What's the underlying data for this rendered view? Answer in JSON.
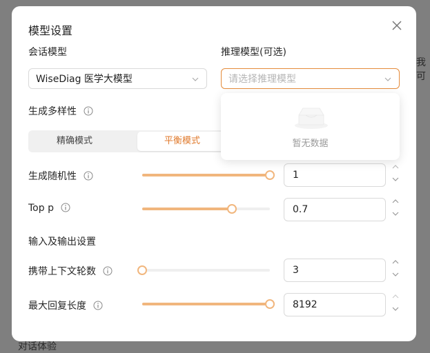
{
  "background": {
    "side_text": "我可",
    "bottom_text": "对话体验"
  },
  "modal": {
    "title": "模型设置",
    "chat_model": {
      "label": "会话模型",
      "value": "WiseDiag 医学大模型"
    },
    "reasoning_model": {
      "label": "推理模型(可选)",
      "placeholder": "请选择推理模型",
      "dropdown_empty_text": "暂无数据"
    },
    "diversity": {
      "label": "生成多样性",
      "modes": [
        "精确模式",
        "平衡模式"
      ],
      "active_mode": "平衡模式"
    },
    "randomness": {
      "label": "生成随机性",
      "value": "1",
      "fraction": 1.0
    },
    "top_p": {
      "label": "Top p",
      "value": "0.7",
      "fraction": 0.7
    },
    "io_section_title": "输入及输出设置",
    "context_rounds": {
      "label": "携带上下文轮数",
      "value": "3",
      "fraction": 0.0
    },
    "max_length": {
      "label": "最大回复长度",
      "value": "8192",
      "fraction": 1.0
    }
  },
  "colors": {
    "accent": "#e07a2c",
    "slider": "#f1b67d",
    "border_focus": "#e48a39"
  }
}
